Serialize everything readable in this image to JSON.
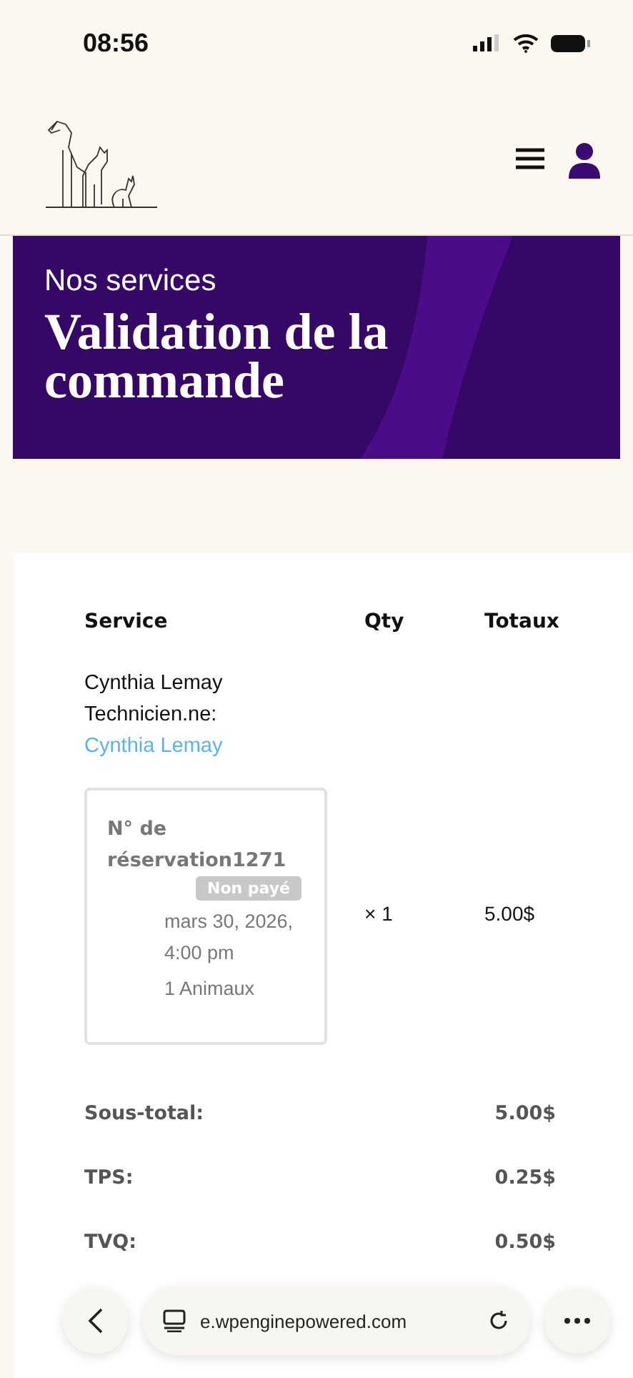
{
  "status_bar": {
    "time": "08:56"
  },
  "hero": {
    "eyebrow": "Nos services",
    "title": "Validation de la commande"
  },
  "table": {
    "columns": [
      "Service",
      "Qty",
      "Totaux"
    ],
    "rows": [
      {
        "name": "Cynthia Lemay",
        "technician_label": "Technicien.ne:",
        "technician_link": "Cynthia Lemay",
        "booking": {
          "number": "N° de réservation1271",
          "status": "Non payé",
          "paid": false,
          "date": "mars 30, 2026, 4:00 pm",
          "pets": "1 Animaux"
        },
        "qty": "× 1",
        "total": "5.00$"
      }
    ]
  },
  "totals": [
    {
      "label": "Sous-total:",
      "value": "5.00$"
    },
    {
      "label": "TPS:",
      "value": "0.25$"
    },
    {
      "label": "TVQ:",
      "value": "0.50$"
    }
  ],
  "browser_bar": {
    "url": "e.wpenginepowered.com"
  }
}
